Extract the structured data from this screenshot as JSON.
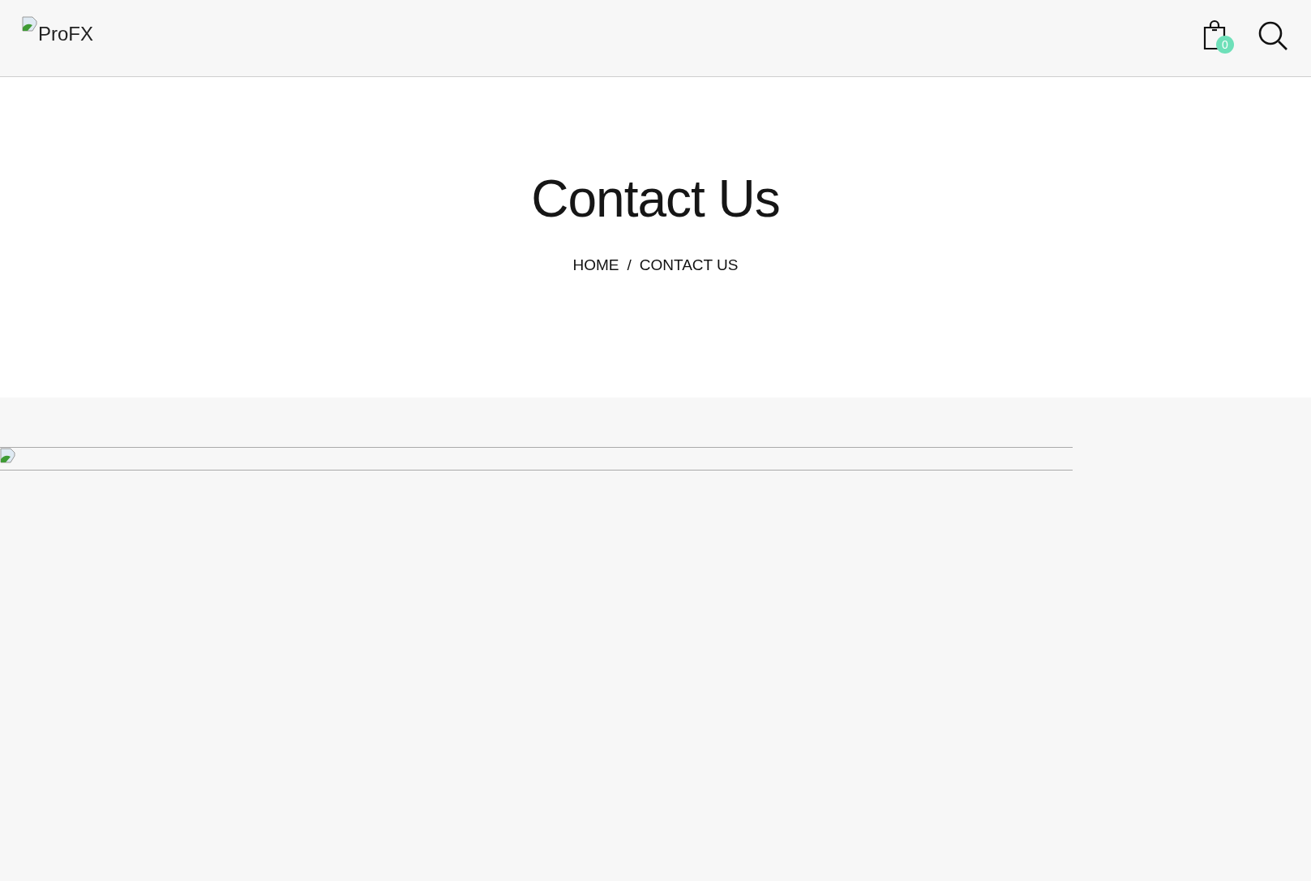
{
  "header": {
    "logo_alt": "ProFX",
    "cart_count": "0"
  },
  "hero": {
    "title": "Contact Us",
    "breadcrumb": {
      "links": [
        "HOME"
      ],
      "separator": "/",
      "current": "CONTACT US"
    }
  }
}
